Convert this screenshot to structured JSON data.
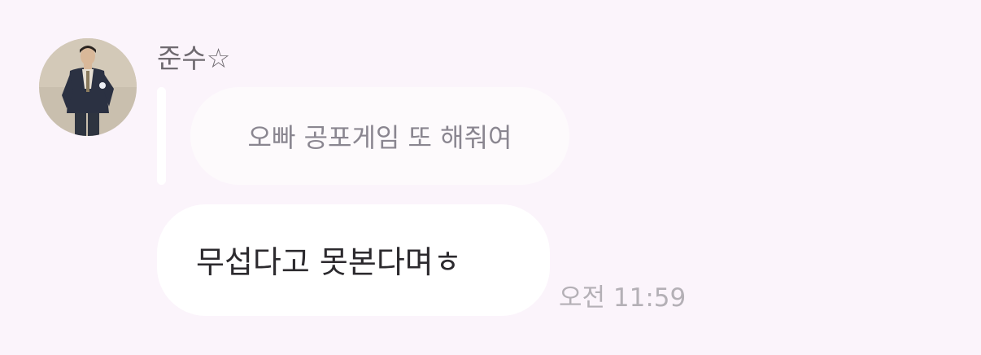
{
  "message": {
    "sender_name": "준수☆",
    "avatar": "profile-photo",
    "quoted_text": "오빠 공포게임 또 해줘여",
    "text": "무섭다고 못본다며ㅎ",
    "time": "오전 11:59"
  },
  "colors": {
    "background": "#fbf4fb",
    "bubble": "#ffffff",
    "quote_bubble": "#fdfafc",
    "timestamp": "#b4b0b6"
  }
}
